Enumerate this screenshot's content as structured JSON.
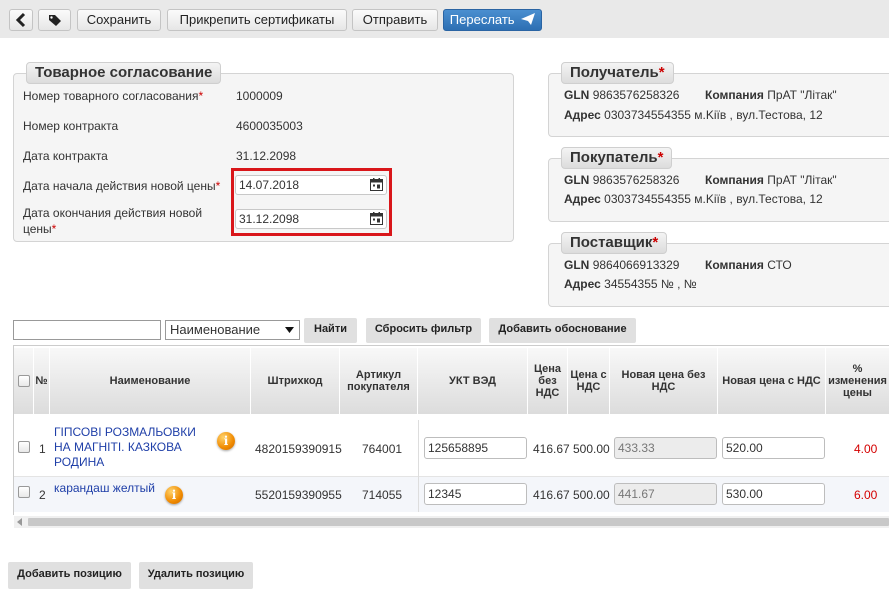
{
  "toolbar": {
    "back_icon": "chevron-left-icon",
    "tag_icon": "tag-icon",
    "save_label": "Сохранить",
    "attach_label": "Прикрепить сертификаты",
    "send_label": "Отправить",
    "forward_label": "Переслать",
    "forward_icon": "paper-plane-icon"
  },
  "agreement": {
    "title": "Товарное согласование",
    "number_label": "Номер товарного согласования",
    "number_value": "1000009",
    "contract_label": "Номер контракта",
    "contract_value": "4600035003",
    "contract_date_label": "Дата контракта",
    "contract_date_value": "31.12.2098",
    "start_label": "Дата начала действия новой цены",
    "start_value": "14.07.2018",
    "end_label_1": "Дата окончания действия новой",
    "end_label_2": "цены",
    "end_value": "31.12.2098",
    "required_mark": "*"
  },
  "recipient": {
    "title": "Получатель",
    "gln_label": "GLN",
    "gln": "9863576258326",
    "company_label": "Компания",
    "company": "ПрАТ \"Літак\"",
    "address_label": "Адрес",
    "address": "0303734554355 м.Kiïв , вул.Тестова, 12"
  },
  "buyer": {
    "title": "Покупатель",
    "gln_label": "GLN",
    "gln": "9863576258326",
    "company_label": "Компания",
    "company": "ПрАТ \"Літак\"",
    "address_label": "Адрес",
    "address": "0303734554355 м.Kiïв , вул.Тестова, 12"
  },
  "supplier": {
    "title": "Поставщик",
    "gln_label": "GLN",
    "gln": "9864066913329",
    "company_label": "Компания",
    "company": "СТО",
    "address_label": "Адрес",
    "address": "34554355 № , №"
  },
  "filter": {
    "search_value": "",
    "select_value": "Наименование",
    "find_label": "Найти",
    "reset_label": "Сбросить фильтр",
    "add_reason_label": "Добавить обоснование"
  },
  "table": {
    "headers": {
      "num": "№",
      "name": "Наименование",
      "barcode": "Штрихкод",
      "article": "Артикул покупателя",
      "ukt": "УКТ ВЭД",
      "price_no_vat": "Цена без НДС",
      "price_vat": "Цена с НДС",
      "new_no_vat": "Новая цена без НДС",
      "new_vat": "Новая цена с НДС",
      "change": "% изменения цены"
    },
    "rows": [
      {
        "num": "1",
        "name": "ГІПСОВІ РОЗМАЛЬОВКИ НА МАГНІТІ. КАЗКОВА РОДИНА",
        "barcode": "4820159390915",
        "article": "764001",
        "ukt": "125658895",
        "price_no_vat": "416.67",
        "price_vat": "500.00",
        "new_no_vat": "433.33",
        "new_vat": "520.00",
        "change": "4.00"
      },
      {
        "num": "2",
        "name": "карандаш желтый",
        "barcode": "5520159390955",
        "article": "714055",
        "ukt": "12345",
        "price_no_vat": "416.67",
        "price_vat": "500.00",
        "new_no_vat": "441.67",
        "new_vat": "530.00",
        "change": "6.00"
      }
    ],
    "info_icon": "info-icon"
  },
  "footer": {
    "add_position_label": "Добавить позицию",
    "delete_position_label": "Удалить позицию"
  },
  "colors": {
    "accent": "#2d6fb3",
    "required": "#cc0000",
    "highlight_box": "#d9161a",
    "product_link": "#1f3fa8",
    "change_value": "#d40000"
  }
}
